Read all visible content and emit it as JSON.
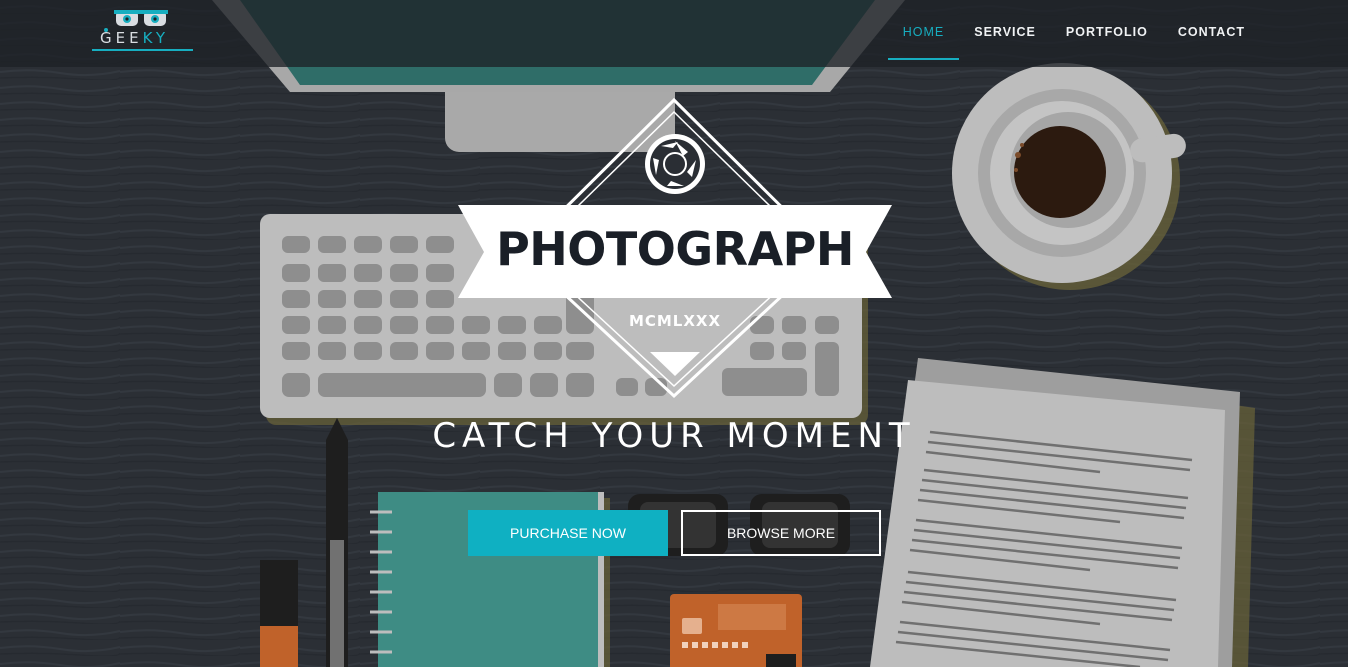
{
  "header": {
    "logo_text_a": "GEE",
    "logo_text_b": "KY",
    "nav": [
      "HOME",
      "SERVICE",
      "PORTFOLIO",
      "CONTACT"
    ],
    "active_nav": "HOME"
  },
  "hero": {
    "badge_title": "PHOTOGRAPH",
    "badge_subtitle": "MCMLXXX",
    "tagline": "CATCH YOUR MOMENT",
    "primary_button": "PURCHASE NOW",
    "secondary_button": "BROWSE MORE"
  },
  "colors": {
    "accent": "#17aec0",
    "background": "#2a2e34"
  }
}
